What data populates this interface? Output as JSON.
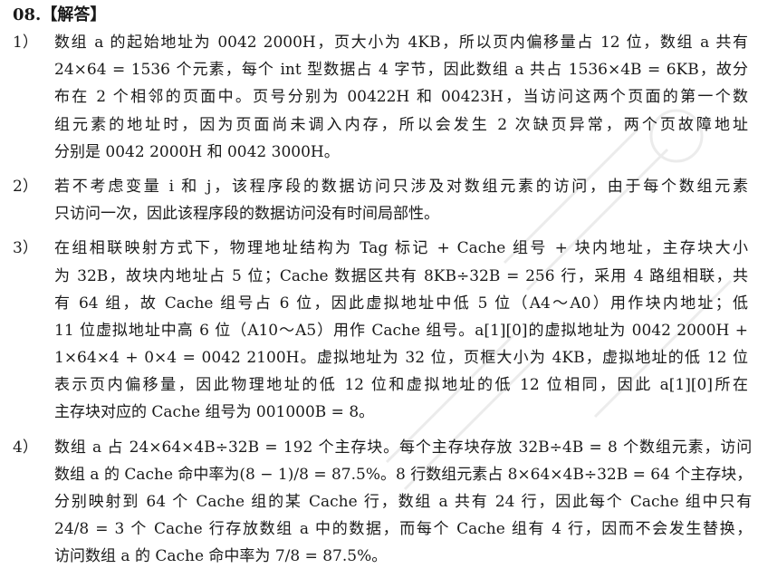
{
  "title": "08.【解答】",
  "answers": [
    {
      "num": "1）",
      "lines": [
        "数组 a 的起始地址为 0042 2000H，页大小为 4KB，所以页内偏移量占 12 位，数组 a 共有",
        "24×64 = 1536 个元素，每个 int 型数据占 4 字节，因此数组 a 共占 1536×4B = 6KB，故分",
        "布在 2 个相邻的页面中。页号分别为 00422H 和 00423H，当访问这两个页面的第一个数",
        "组元素的地址时，因为页面尚未调入内存，所以会发生 2 次缺页异常，两个页故障地址",
        "分别是 0042 2000H 和 0042 3000H。"
      ]
    },
    {
      "num": "2）",
      "lines": [
        "若不考虑变量 i 和 j，该程序段的数据访问只涉及对数组元素的访问，由于每个数组元素",
        "只访问一次，因此该程序段的数据访问没有时间局部性。"
      ]
    },
    {
      "num": "3）",
      "lines": [
        "在组相联映射方式下，物理地址结构为 Tag 标记 + Cache 组号 + 块内地址，主存块大小",
        "为 32B，故块内地址占 5 位；Cache 数据区共有 8KB÷32B = 256 行，采用 4 路组相联，共",
        "有 64 组，故 Cache 组号占 6 位，因此虚拟地址中低 5 位（A4～A0）用作块内地址；低",
        "11 位虚拟地址中高 6 位（A10～A5）用作 Cache 组号。a[1][0]的虚拟地址为 0042 2000H +",
        "1×64×4 + 0×4 = 0042 2100H。虚拟地址为 32 位，页框大小为 4KB，虚拟地址的低 12 位",
        "表示页内偏移量，因此物理地址的低 12 位和虚拟地址的低 12 位相同，因此 a[1][0]所在",
        "主存块对应的 Cache 组号为 001000B = 8。"
      ]
    },
    {
      "num": "4）",
      "lines": [
        "数组 a 占 24×64×4B÷32B = 192 个主存块。每个主存块存放 32B÷4B = 8 个数组元素，访问",
        "数组 a 的 Cache 命中率为(8 − 1)/8 = 87.5%。8 行数组元素占 8×64×4B÷32B = 64 个主存块，",
        "分别映射到 64 个 Cache 组的某 Cache 行，数组 a 共有 24 行，因此每个 Cache 组中只有",
        "24/8 = 3 个 Cache 行存放数组 a 中的数据，而每个 Cache 组有 4 行，因而不会发生替换，",
        "访问数组 a 的 Cache 命中率为 7/8 = 87.5%。"
      ]
    }
  ]
}
